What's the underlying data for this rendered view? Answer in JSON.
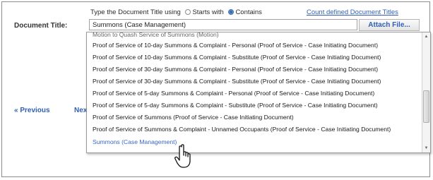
{
  "hint": {
    "prefix": "Type the Document Title using",
    "option_starts": "Starts with",
    "option_contains": "Contains",
    "selected": "Contains"
  },
  "count_link": "Count defined Document Titles",
  "document_title": {
    "label": "Document Title:",
    "value": "Summons (Case Management)"
  },
  "attach_button": "Attach File...",
  "nav": {
    "previous": "« Previous",
    "next": "Next"
  },
  "dropdown": {
    "partial_item": "Motion to Quash Service of Summons (Motion)",
    "items": [
      "Proof of Service of 10-day Summons & Complaint - Personal (Proof of Service - Case Initiating Document)",
      "Proof of Service of 10-day Summons & Complaint - Substitute (Proof of Service - Case Initiating Document)",
      "Proof of Service of 30-day Summons & Complaint - Personal (Proof of Service - Case Initiating Document)",
      "Proof of Service of 30-day Summons & Complaint - Substitute (Proof of Service - Case Initiating Document)",
      "Proof of Service of 5-day Summons & Complaint - Personal (Proof of Service - Case Initiating Document)",
      "Proof of Service of 5-day Summons & Complaint - Substitute (Proof of Service - Case Initiating Document)",
      "Proof of Service of Summons (Proof of Service - Case Initiating Document)",
      "Proof of Service of Summons & Complaint - Unnamed Occupants (Proof of Service - Case Initiating Document)"
    ],
    "highlighted_item": "Summons (Case Management)"
  }
}
